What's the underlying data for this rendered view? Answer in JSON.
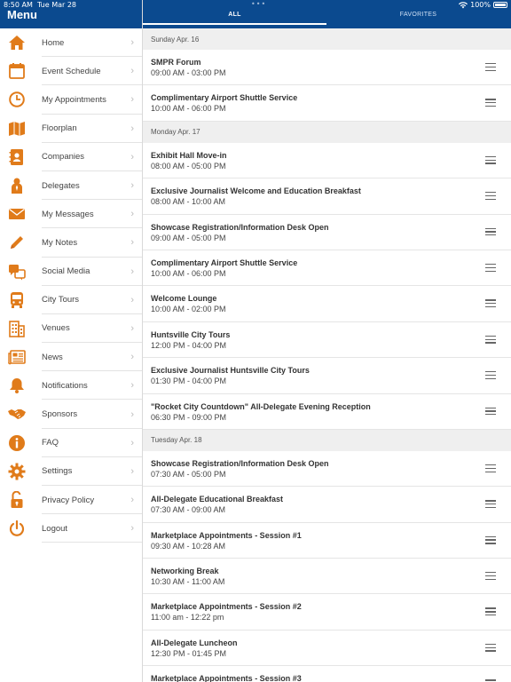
{
  "status_bar": {
    "time": "8:50 AM",
    "date": "Tue Mar 28",
    "battery": "100%"
  },
  "sidebar": {
    "title": "Menu",
    "items": [
      {
        "label": "Home",
        "icon": "home-icon",
        "color": "#e07b1a"
      },
      {
        "label": "Event Schedule",
        "icon": "calendar-icon",
        "color": "#e07b1a"
      },
      {
        "label": "My Appointments",
        "icon": "clock-icon",
        "color": "#e07b1a"
      },
      {
        "label": "Floorplan",
        "icon": "map-icon",
        "color": "#e07b1a"
      },
      {
        "label": "Companies",
        "icon": "address-book-icon",
        "color": "#e07b1a"
      },
      {
        "label": "Delegates",
        "icon": "person-icon",
        "color": "#e07b1a"
      },
      {
        "label": "My Messages",
        "icon": "envelope-icon",
        "color": "#e07b1a"
      },
      {
        "label": "My Notes",
        "icon": "pencil-icon",
        "color": "#e07b1a"
      },
      {
        "label": "Social Media",
        "icon": "chat-bubbles-icon",
        "color": "#e07b1a"
      },
      {
        "label": "City Tours",
        "icon": "bus-icon",
        "color": "#e07b1a"
      },
      {
        "label": "Venues",
        "icon": "building-icon",
        "color": "#e07b1a"
      },
      {
        "label": "News",
        "icon": "newspaper-icon",
        "color": "#e07b1a"
      },
      {
        "label": "Notifications",
        "icon": "bell-icon",
        "color": "#e07b1a"
      },
      {
        "label": "Sponsors",
        "icon": "handshake-icon",
        "color": "#e07b1a"
      },
      {
        "label": "FAQ",
        "icon": "info-icon",
        "color": "#e07b1a"
      },
      {
        "label": "Settings",
        "icon": "gear-icon",
        "color": "#e07b1a"
      },
      {
        "label": "Privacy Policy",
        "icon": "lock-icon",
        "color": "#e07b1a"
      },
      {
        "label": "Logout",
        "icon": "power-icon",
        "color": "#e07b1a"
      }
    ]
  },
  "tabs": {
    "all": "ALL",
    "favorites": "FAVORITES",
    "active": "all"
  },
  "schedule": [
    {
      "day": "Sunday Apr. 16",
      "events": [
        {
          "name": "SMPR Forum",
          "time": "09:00 AM - 03:00 PM"
        },
        {
          "name": "Complimentary Airport Shuttle Service",
          "time": "10:00 AM - 06:00 PM"
        }
      ]
    },
    {
      "day": "Monday Apr. 17",
      "events": [
        {
          "name": "Exhibit Hall Move-in",
          "time": "08:00 AM - 05:00 PM"
        },
        {
          "name": "Exclusive Journalist Welcome and Education Breakfast",
          "time": "08:00 AM - 10:00 AM"
        },
        {
          "name": "Showcase Registration/Information Desk Open",
          "time": "09:00 AM - 05:00 PM"
        },
        {
          "name": "Complimentary Airport Shuttle Service",
          "time": "10:00 AM - 06:00 PM"
        },
        {
          "name": "Welcome Lounge",
          "time": "10:00 AM - 02:00 PM"
        },
        {
          "name": "Huntsville City Tours",
          "time": "12:00 PM - 04:00 PM"
        },
        {
          "name": "Exclusive Journalist Huntsville City Tours",
          "time": "01:30 PM - 04:00 PM"
        },
        {
          "name": "\"Rocket City Countdown\" All-Delegate Evening Reception",
          "time": "06:30 PM - 09:00 PM"
        }
      ]
    },
    {
      "day": "Tuesday Apr. 18",
      "events": [
        {
          "name": "Showcase Registration/Information Desk Open",
          "time": "07:30 AM - 05:00 PM"
        },
        {
          "name": "All-Delegate Educational Breakfast",
          "time": "07:30 AM - 09:00 AM"
        },
        {
          "name": "Marketplace Appointments - Session #1",
          "time": "09:30 AM - 10:28 AM"
        },
        {
          "name": "Networking Break",
          "time": "10:30 AM - 11:00 AM"
        },
        {
          "name": "Marketplace Appointments - Session #2",
          "time": "11:00 am - 12:22 pm"
        },
        {
          "name": "All-Delegate Luncheon",
          "time": "12:30 PM - 01:45 PM"
        },
        {
          "name": "Marketplace Appointments - Session #3",
          "time": ""
        }
      ]
    }
  ],
  "colors": {
    "header_blue": "#0b4a8f",
    "icon_orange": "#e07b1a"
  }
}
